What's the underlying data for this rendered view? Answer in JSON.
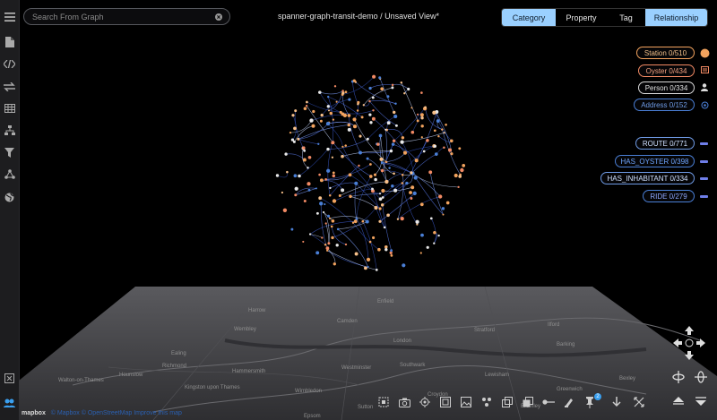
{
  "search": {
    "placeholder": "Search From Graph"
  },
  "title": "spanner-graph-transit-demo / Unsaved View*",
  "tabs": [
    {
      "label": "Category",
      "active": true
    },
    {
      "label": "Property",
      "active": false
    },
    {
      "label": "Tag",
      "active": false
    },
    {
      "label": "Relationship",
      "active": true
    }
  ],
  "node_legend": [
    {
      "label": "Station 0/510",
      "color": "#f2a35e",
      "icon": "circle-dot-icon"
    },
    {
      "label": "Oyster 0/434",
      "color": "#f28a64",
      "icon": "card-icon"
    },
    {
      "label": "Person 0/334",
      "color": "#d8d8d8",
      "icon": "person-icon"
    },
    {
      "label": "Address 0/152",
      "color": "#4a7fd6",
      "icon": "location-icon"
    }
  ],
  "edge_legend": [
    {
      "label": "ROUTE 0/771",
      "color": "#cfe0ff"
    },
    {
      "label": "HAS_OYSTER 0/398",
      "color": "#6fa6ff"
    },
    {
      "label": "HAS_INHABITANT 0/334",
      "color": "#cfe0ff"
    },
    {
      "label": "RIDE 0/279",
      "color": "#8ea8ff"
    }
  ],
  "map_labels": [
    "London",
    "Wembley",
    "Westminster",
    "Croydon",
    "Camden",
    "Greenwich",
    "Ealing",
    "Hammersmith",
    "Stratford",
    "Hounslow",
    "Bromley",
    "Walton-on-Thames",
    "Kingston upon Thames",
    "Richmond",
    "Lewisham",
    "Barking",
    "Enfield",
    "Harrow",
    "Southwark",
    "Sutton",
    "Epsom",
    "Wimbledon",
    "Bexley",
    "Ilford"
  ],
  "attribution": {
    "logo": "mapbox",
    "links": "© Mapbox  © OpenStreetMap  Improve this map"
  },
  "toolbar_badge": "2",
  "colors": {
    "accent": "#9ad0ff",
    "station": "#f2a35e",
    "edge": "#6f7ee8",
    "background": "#000000"
  }
}
